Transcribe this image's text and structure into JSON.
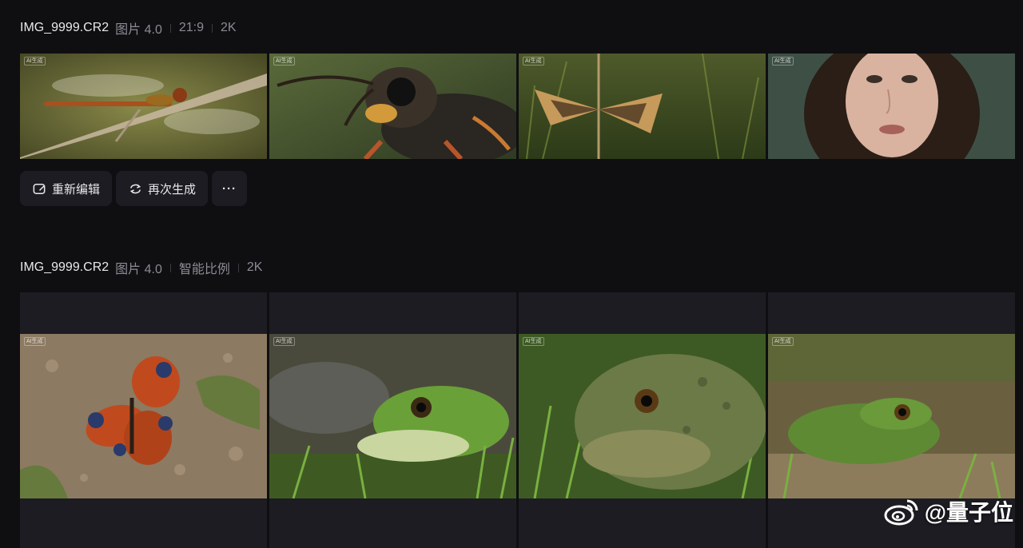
{
  "section1": {
    "filename": "IMG_9999.CR2",
    "model": "图片 4.0",
    "ratio": "21:9",
    "resolution": "2K",
    "images": [
      {
        "badge": "AI生成",
        "subject": "dragonfly"
      },
      {
        "badge": "AI生成",
        "subject": "wasp"
      },
      {
        "badge": "AI生成",
        "subject": "moth"
      },
      {
        "badge": "AI生成",
        "subject": "portrait"
      }
    ],
    "actions": {
      "edit_label": "重新编辑",
      "regenerate_label": "再次生成",
      "more_label": "···"
    }
  },
  "section2": {
    "filename": "IMG_9999.CR2",
    "model": "图片 4.0",
    "ratio": "智能比例",
    "resolution": "2K",
    "images": [
      {
        "badge": "AI生成",
        "subject": "butterfly"
      },
      {
        "badge": "AI生成",
        "subject": "tree-frog"
      },
      {
        "badge": "AI生成",
        "subject": "toad"
      },
      {
        "badge": "AI生成",
        "subject": "frog"
      }
    ]
  },
  "watermark": {
    "text": "@量子位",
    "icon": "weibo-icon"
  },
  "colors": {
    "background": "#0f0f12",
    "button_bg": "#1c1c22",
    "text": "#e9e9ec",
    "muted": "#8b8b93"
  }
}
